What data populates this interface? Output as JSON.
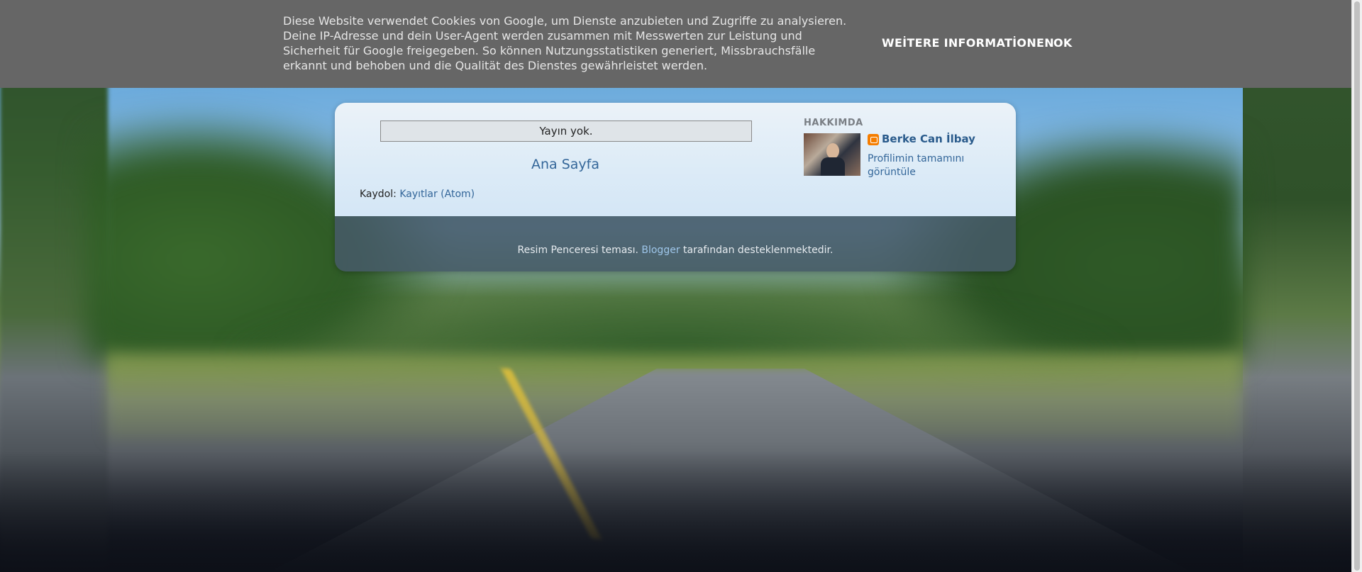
{
  "cookie_banner": {
    "text": "Diese Website verwendet Cookies von Google, um Dienste anzubieten und Zugriffe zu analysieren. Deine IP-Adresse und dein User-Agent werden zusammen mit Messwerten zur Leistung und Sicherheit für Google freigegeben. So können Nutzungsstatistiken generiert, Missbrauchsfälle erkannt und behoben und die Qualität des Dienstes gewährleistet werden.",
    "more_info_label": "WEİTERE INFORMATİONEN",
    "ok_label": "OK"
  },
  "main": {
    "no_posts": "Yayın yok.",
    "home_link": "Ana Sayfa",
    "subscribe_label": "Kaydol:",
    "subscribe_link": "Kayıtlar (Atom)"
  },
  "sidebar": {
    "about_heading": "HAKKIMDA",
    "author_name": "Berke Can İlbay",
    "profile_link": "Profilimin tamamını görüntüle"
  },
  "footer": {
    "theme_text": "Resim Penceresi teması.",
    "blogger_link": "Blogger",
    "powered_text": "tarafından desteklenmektedir."
  },
  "icons": {
    "blogger": "blogger-icon"
  },
  "colors": {
    "banner_bg": "#666666",
    "link": "#336699",
    "footer_bg": "#465a66",
    "blogger_orange": "#f57d00"
  }
}
